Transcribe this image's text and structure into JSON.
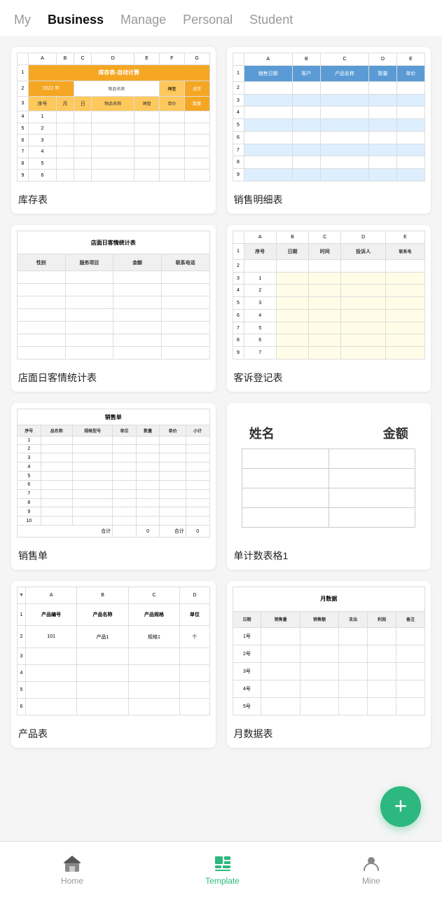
{
  "nav": {
    "items": [
      {
        "label": "My",
        "active": false
      },
      {
        "label": "Business",
        "active": true
      },
      {
        "label": "Manage",
        "active": false
      },
      {
        "label": "Personal",
        "active": false
      },
      {
        "label": "Student",
        "active": false
      }
    ]
  },
  "templates": [
    {
      "id": "inventory",
      "label": "库存表",
      "type": "inventory"
    },
    {
      "id": "sales-detail",
      "label": "销售明细表",
      "type": "sales-detail"
    },
    {
      "id": "customer-stat",
      "label": "店面日客情统计表",
      "type": "customer-stat"
    },
    {
      "id": "complaint",
      "label": "客诉登记表",
      "type": "complaint"
    },
    {
      "id": "sales-order",
      "label": "销售单",
      "type": "sales-order"
    },
    {
      "id": "count-table",
      "label": "单计数表格1",
      "type": "count-table"
    },
    {
      "id": "product",
      "label": "产品表",
      "type": "product"
    },
    {
      "id": "monthly",
      "label": "月数据表",
      "type": "monthly"
    }
  ],
  "bottom_nav": {
    "tabs": [
      {
        "label": "Home",
        "active": false,
        "icon": "home"
      },
      {
        "label": "Template",
        "active": true,
        "icon": "template"
      },
      {
        "label": "Mine",
        "active": false,
        "icon": "mine"
      }
    ]
  },
  "fab": {
    "label": "+"
  }
}
